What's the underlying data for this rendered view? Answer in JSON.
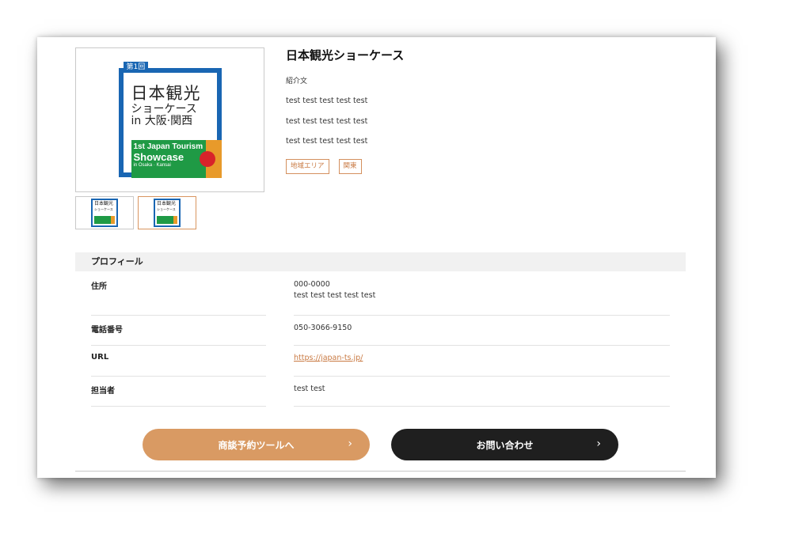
{
  "product": {
    "title": "日本観光ショーケース",
    "intro_label": "紹介文",
    "descriptions": [
      "test test test test test",
      "test test test test test",
      "test test test test test"
    ],
    "tags": [
      "地域エリア",
      "関東"
    ]
  },
  "logo": {
    "badge": "第1回",
    "jp_line1": "日本観光",
    "jp_line2": "ショーケース",
    "jp_line3": "in 大阪·関西",
    "en_line1": "1st Japan Tourism",
    "en_line2": "Showcase",
    "en_line3": "in Osaka · Kansai"
  },
  "profile": {
    "header": "プロフィール",
    "address_label": "住所",
    "address_postal": "000-0000",
    "address_line": "test test test test test",
    "phone_label": "電話番号",
    "phone_value": "050-3066-9150",
    "url_label": "URL",
    "url_value": "https://japan-ts.jp/",
    "contact_label": "担当者",
    "contact_value": "test test"
  },
  "buttons": {
    "tool_label": "商談予約ツールへ",
    "contact_label": "お問い合わせ",
    "chevron": "›"
  },
  "colors": {
    "accent": "#d99a63",
    "dark": "#1f1f1f",
    "logo_blue": "#1966b3",
    "logo_green": "#1f9a45"
  }
}
